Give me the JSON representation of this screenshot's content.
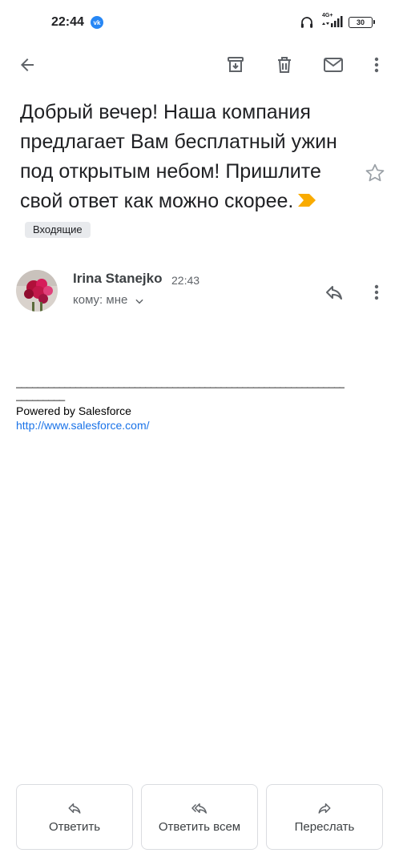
{
  "status_bar": {
    "time": "22:44",
    "network": "4G+",
    "battery": "30"
  },
  "toolbar": {
    "back": "back-arrow-icon",
    "archive": "archive-icon",
    "delete": "trash-icon",
    "mark_unread": "mail-icon",
    "more": "more-vert-icon"
  },
  "email": {
    "subject": "Добрый вечер! Наша компания предлагает Вам бесплатный ужин под открытым небом! Пришлите свой ответ как можно скорее.",
    "label": "Входящие",
    "sender_name": "Irina Stanejko",
    "time": "22:43",
    "recipient": "кому: мне",
    "body": {
      "divider": "_____________________________________________________________",
      "divider2": "_________",
      "powered_by": "Powered by Salesforce",
      "link": "http://www.salesforce.com/"
    }
  },
  "actions": {
    "reply": "Ответить",
    "reply_all": "Ответить всем",
    "forward": "Переслать"
  },
  "colors": {
    "importance": "#f9ab00",
    "link": "#1a73e8",
    "vk": "#2787f5"
  }
}
